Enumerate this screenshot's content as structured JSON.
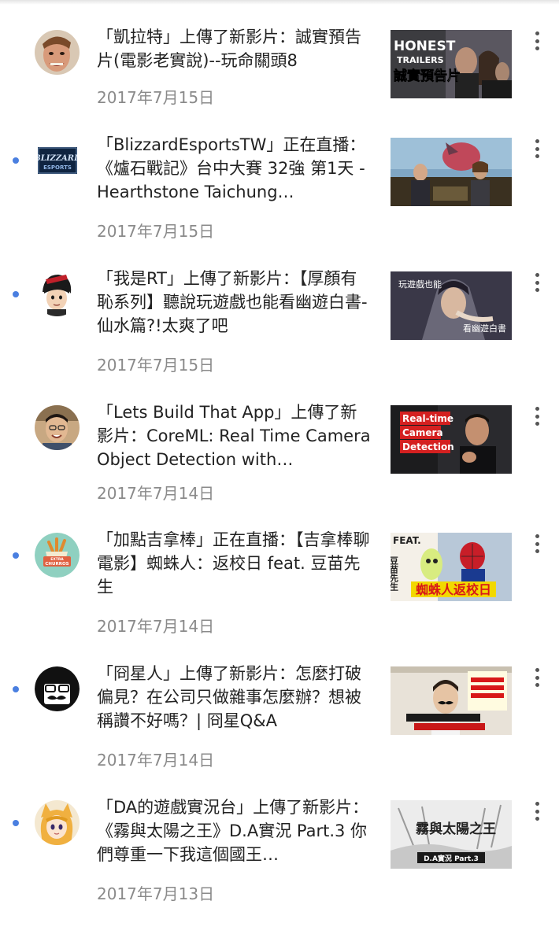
{
  "feed": {
    "items": [
      {
        "title": "「凱拉特」上傳了新影片：誠實預告片(電影老實說)--玩命關頭8",
        "date": "2017年7月15日",
        "unread": false,
        "avatar": "person-avatar",
        "thumbnail_text": [
          "HONEST",
          "TRAILERS",
          "誠實預告片"
        ]
      },
      {
        "title": "「BlizzardEsportsTW」正在直播：《爐石戰記》台中大賽 32強 第1天 - Hearthstone Taichung…",
        "date": "2017年7月15日",
        "unread": true,
        "avatar": "blizzard-esports-logo",
        "avatar_text": [
          "BLIZZARD",
          "ESPORTS"
        ]
      },
      {
        "title": "「我是RT」上傳了新影片：【厚顏有恥系列】聽說玩遊戲也能看幽遊白書-仙水篇?!太爽了吧",
        "date": "2017年7月15日",
        "unread": true,
        "avatar": "cartoon-avatar",
        "thumbnail_text": [
          "玩遊戲也能",
          "看幽遊白書"
        ]
      },
      {
        "title": "「Lets Build That App」上傳了新影片：CoreML: Real Time Camera Object Detection with…",
        "date": "2017年7月14日",
        "unread": false,
        "avatar": "person-avatar",
        "thumbnail_text": [
          "Real-time",
          "Camera",
          "Detection"
        ]
      },
      {
        "title": "「加點吉拿棒」正在直播：【吉拿棒聊電影】蜘蛛人：返校日 feat. 豆苗先生",
        "date": "2017年7月14日",
        "unread": true,
        "avatar": "extra-churros-logo",
        "avatar_text": [
          "EXTRA",
          "CHURROS"
        ],
        "thumbnail_text": [
          "FEAT.",
          "豆苗先生",
          "蜘蛛人返校日"
        ]
      },
      {
        "title": "「冏星人」上傳了新影片：怎麼打破偏見？在公司只做雜事怎麼辦？想被稱讚不好嗎？| 冏星Q&A",
        "date": "2017年7月14日",
        "unread": true,
        "avatar": "mustache-avatar"
      },
      {
        "title": "「DA的遊戲實況台」上傳了新影片：《霧與太陽之王》D.A實況 Part.3 你們尊重一下我這個國王…",
        "date": "2017年7月13日",
        "unread": true,
        "avatar": "anime-avatar",
        "thumbnail_text": [
          "霧與太陽之王",
          "D.A實況 Part.3"
        ]
      }
    ]
  },
  "colors": {
    "unread_dot": "#4a7fe0",
    "date": "#8a8a8a",
    "title": "#222222"
  }
}
